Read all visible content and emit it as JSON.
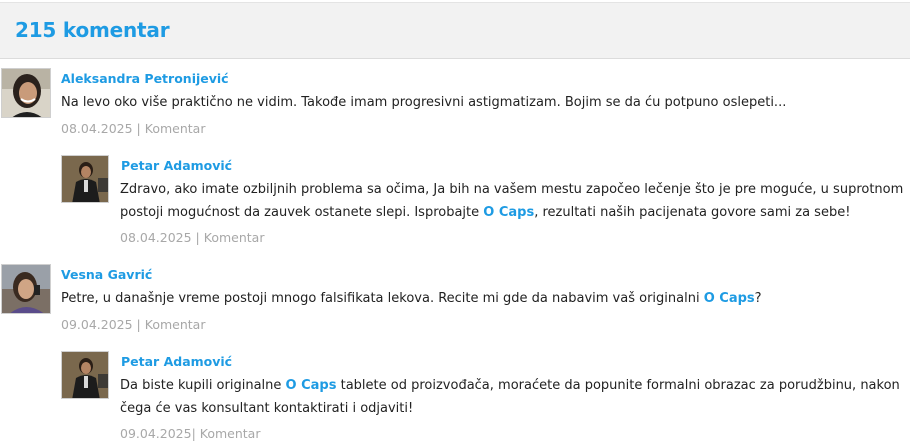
{
  "header": {
    "title": "215 komentar"
  },
  "comments": [
    {
      "author": "Aleksandra Petronijević",
      "text": "Na levo oko više praktično ne vidim. Takođe imam progresivni astigmatizam. Bojim se da ću potpuno oslepeti...",
      "date": "08.04.2025",
      "separator": " | ",
      "reply_label": "Komentar"
    },
    {
      "author": "Petar Adamović",
      "text_before": "Zdravo, ako imate ozbiljnih problema sa očima, Ja bih na vašem mestu započeo lečenje što je pre moguće, u suprotnom postoji mogućnost da zauvek ostanete slepi. Isprobajte ",
      "brand": "O Caps",
      "text_after": ", rezultati naših pacijenata govore sami za sebe!",
      "date": "08.04.2025",
      "separator": " | ",
      "reply_label": "Komentar"
    },
    {
      "author": "Vesna Gavrić",
      "text_before": "Petre, u današnje vreme postoji mnogo falsifikata lekova. Recite mi gde da nabavim vaš originalni ",
      "brand": "O Caps",
      "text_after": "?",
      "date": "09.04.2025",
      "separator": " | ",
      "reply_label": "Komentar"
    },
    {
      "author": "Petar Adamović",
      "text_before": "Da biste kupili originalne ",
      "brand": "O Caps",
      "text_after": " tablete od proizvođača, moraćete da popunite formalni obrazac za porudžbinu, nakon čega će vas konsultant kontaktirati i odjaviti!",
      "date": "09.04.2025",
      "separator": "| ",
      "reply_label": "Komentar"
    }
  ],
  "colors": {
    "accent": "#1e9be3",
    "meta": "#a8a8a8",
    "text": "#222222",
    "header_bg": "#f2f2f2"
  }
}
